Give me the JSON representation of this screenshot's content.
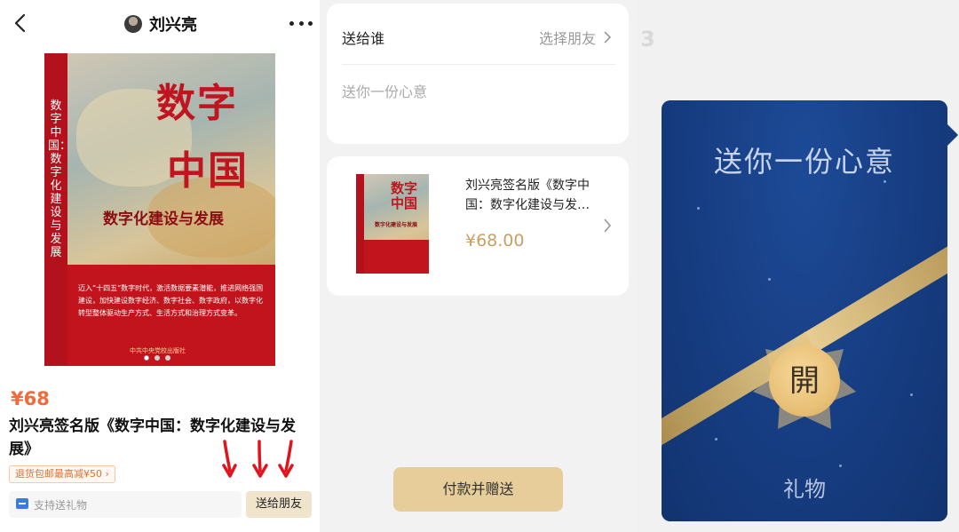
{
  "left": {
    "header": {
      "title": "刘兴亮"
    },
    "cover": {
      "spine_text": "数字中国：数字化建设与发展",
      "title_line1": "数字",
      "title_line2": "中国",
      "subtitle": "数字化建设与发展",
      "blurb": "迈入“十四五”数字时代，激活数据要素潜能，推进网络强国建设，加快建设数字经济、数字社会、数字政府，以数字化转型整体驱动生产方式、生活方式和治理方式变革。",
      "publisher": "中共中央党校出版社"
    },
    "price": "¥68",
    "product_name": "刘兴亮签名版《数字中国：数字化建设与发展》",
    "promo_chip": "退货包邮最高减¥50 ›",
    "gift_placeholder": "支持送礼物",
    "send_button": "送给朋友"
  },
  "middle": {
    "recipient_label": "送给谁",
    "recipient_action": "选择朋友",
    "message_placeholder": "送你一份心意",
    "product": {
      "thumb_title": "数字中国",
      "thumb_subtitle": "数字化建设与发展",
      "name": "刘兴亮签名版《数字中国：数字化建设与发…",
      "price": "¥68.00"
    },
    "pay_button": "付款并赠送"
  },
  "right": {
    "envelope_title": "送你一份心意",
    "open_label": "開",
    "gift_label": "礼物",
    "colors": {
      "envelope": "#163c80",
      "seal": "#e9c178"
    }
  }
}
